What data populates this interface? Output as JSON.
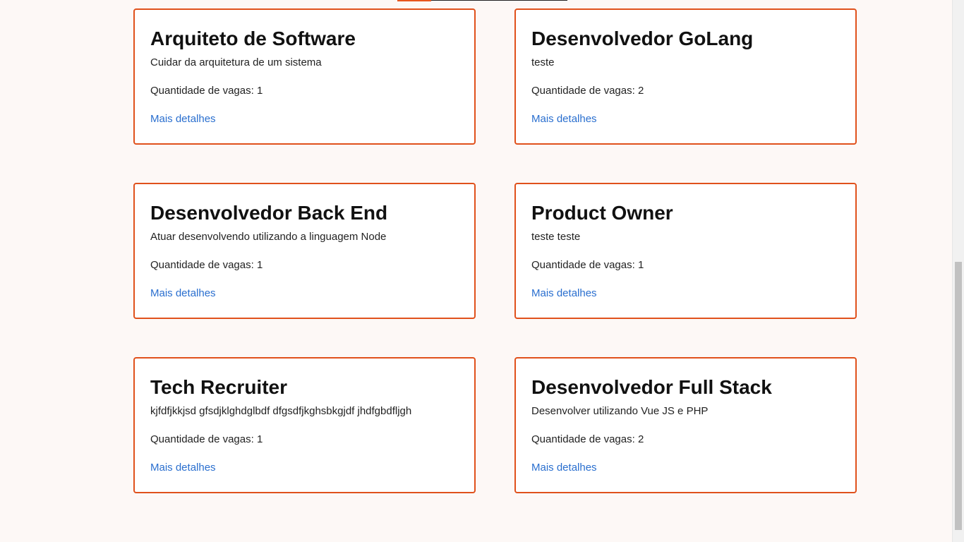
{
  "jobs": {
    "qty_label": "Quantidade de vagas:",
    "link_label": "Mais detalhes",
    "items": [
      {
        "title": "Arquiteto de Software",
        "description": "Cuidar da arquitetura de um sistema",
        "quantity": "1"
      },
      {
        "title": "Desenvolvedor GoLang",
        "description": "teste",
        "quantity": "2"
      },
      {
        "title": "Desenvolvedor Back End",
        "description": "Atuar desenvolvendo utilizando a linguagem Node",
        "quantity": "1"
      },
      {
        "title": "Product Owner",
        "description": "teste teste",
        "quantity": "1"
      },
      {
        "title": "Tech Recruiter",
        "description": "kjfdfjkkjsd gfsdjklghdglbdf dfgsdfjkghsbkgjdf jhdfgbdfljgh",
        "quantity": "1"
      },
      {
        "title": "Desenvolvedor Full Stack",
        "description": "Desenvolver utilizando Vue JS e PHP",
        "quantity": "2"
      }
    ]
  },
  "colors": {
    "background": "#fdf8f6",
    "card_border": "#e0511c",
    "link": "#2a6fcf",
    "accent": "#e8561e"
  }
}
